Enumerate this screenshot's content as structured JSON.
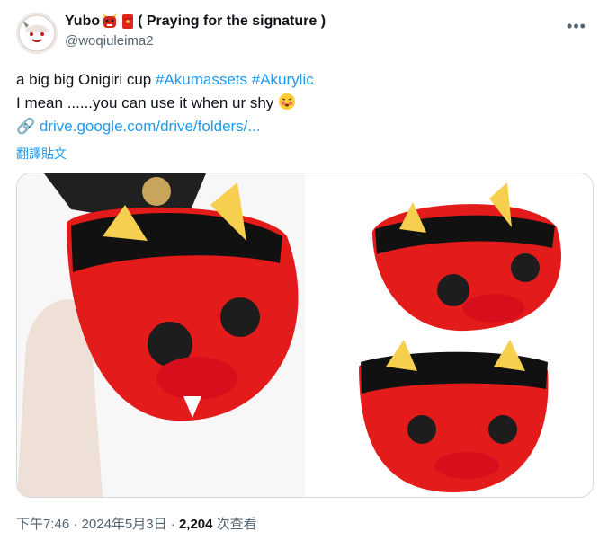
{
  "author": {
    "display_name": "Yubo",
    "title_suffix": "( Praying for the signature )",
    "handle": "@woqiuleima2"
  },
  "post": {
    "line1_text": "a big big Onigiri cup ",
    "hashtag1": "#Akumassets",
    "hashtag2": "#Akurylic",
    "line2_text": "I mean ......you can use it when ur shy",
    "link_text": "drive.google.com/drive/folders/...",
    "translate_label": "翻譯貼文"
  },
  "meta": {
    "time": "下午7:46",
    "date": "2024年5月3日",
    "views_count": "2,204",
    "views_label": "次查看"
  },
  "icons": {
    "more": "more-icon",
    "link": "link-icon",
    "shy_emoji": "shy-emoji",
    "badge1": "oni-mask-emoji",
    "badge2": "red-envelope-emoji"
  },
  "colors": {
    "accent": "#1d9bf0",
    "cup_red": "#e31b1b",
    "secondary_text": "#536471"
  }
}
